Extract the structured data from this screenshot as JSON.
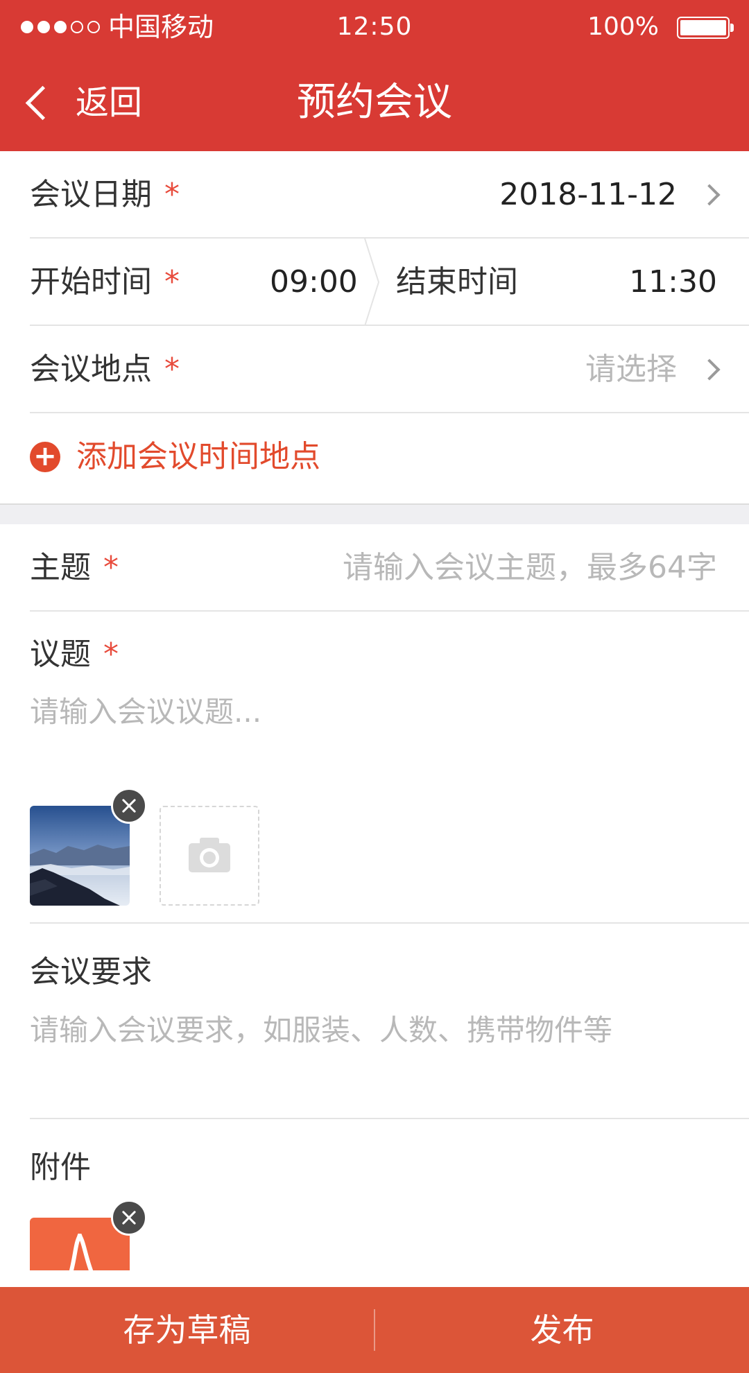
{
  "status_bar": {
    "carrier": "中国移动",
    "time": "12:50",
    "battery": "100%",
    "signal_bars_filled": 3,
    "signal_bars_total": 5
  },
  "nav": {
    "back_label": "返回",
    "title": "预约会议"
  },
  "form": {
    "date": {
      "label": "会议日期",
      "required_mark": "*",
      "value": "2018-11-12"
    },
    "time": {
      "start_label": "开始时间",
      "required_mark": "*",
      "start_value": "09:00",
      "end_label": "结束时间",
      "end_value": "11:30"
    },
    "location": {
      "label": "会议地点",
      "required_mark": "*",
      "placeholder": "请选择"
    },
    "add_time_location": {
      "icon": "+",
      "label": "添加会议时间地点"
    },
    "subject": {
      "label": "主题",
      "required_mark": "*",
      "placeholder": "请输入会议主题，最多64字"
    },
    "agenda": {
      "label": "议题",
      "required_mark": "*",
      "placeholder": "请输入会议议题..."
    },
    "requirements": {
      "label": "会议要求",
      "placeholder": "请输入会议要求，如服装、人数、携带物件等"
    },
    "attachments": {
      "label": "附件"
    }
  },
  "bottom": {
    "draft_label": "存为草稿",
    "publish_label": "发布"
  },
  "colors": {
    "brand_red": "#d83a34",
    "accent_orange": "#e24a2c",
    "bottom_bar": "#dc5538"
  }
}
